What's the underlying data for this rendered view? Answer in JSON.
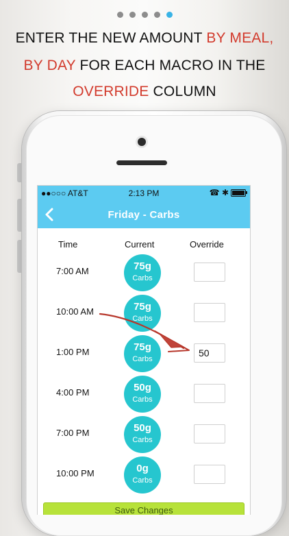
{
  "pager": {
    "count": 5,
    "active": 4
  },
  "headline": {
    "line1": {
      "plain": "ENTER THE NEW AMOUNT ",
      "highlight": "BY MEAL,"
    },
    "line2": {
      "highlight": "BY DAY",
      "plain": " FOR EACH MACRO IN THE"
    },
    "line3": {
      "highlight": "OVERRIDE",
      "plain": " COLUMN"
    }
  },
  "status_bar": {
    "carrier": "●●○○○ AT&T",
    "time": "2:13 PM",
    "right_icons": "☎ ✱"
  },
  "nav": {
    "title": "Friday - Carbs"
  },
  "columns": {
    "time": "Time",
    "current": "Current",
    "override": "Override"
  },
  "rows": [
    {
      "time": "7:00 AM",
      "amount": "75g",
      "unit": "Carbs",
      "override": ""
    },
    {
      "time": "10:00 AM",
      "amount": "75g",
      "unit": "Carbs",
      "override": ""
    },
    {
      "time": "1:00 PM",
      "amount": "75g",
      "unit": "Carbs",
      "override": "50"
    },
    {
      "time": "4:00 PM",
      "amount": "50g",
      "unit": "Carbs",
      "override": ""
    },
    {
      "time": "7:00 PM",
      "amount": "50g",
      "unit": "Carbs",
      "override": ""
    },
    {
      "time": "10:00 PM",
      "amount": "0g",
      "unit": "Carbs",
      "override": ""
    }
  ],
  "save_button": {
    "label": "Save Changes"
  },
  "colors": {
    "accent": "#5ccbf1",
    "circle": "#26c6cf",
    "highlight": "#d23a2c",
    "save": "#b7e23a"
  }
}
